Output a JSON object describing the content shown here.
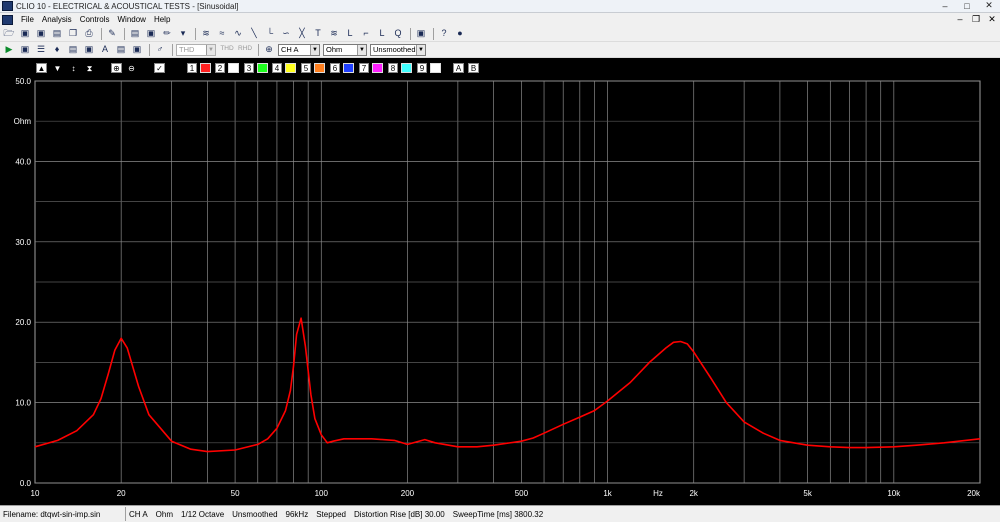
{
  "window": {
    "title": "CLIO 10 - ELECTRICAL & ACOUSTICAL TESTS - [Sinusoidal]"
  },
  "menu": [
    "File",
    "Analysis",
    "Controls",
    "Window",
    "Help"
  ],
  "toolbar2": {
    "thd_dropdown": "THD",
    "thd_label": "THD",
    "rhd_label": "RHD",
    "channel_dropdown": "CH A",
    "unit_dropdown": "Ohm",
    "smoothing_dropdown": "Unsmoothed"
  },
  "graph_toolbar": {
    "check_mark": "✓",
    "buttons": [
      "1",
      "2",
      "3",
      "4",
      "5",
      "6",
      "7",
      "8",
      "9"
    ],
    "a_label": "A",
    "b_label": "B",
    "colors": [
      "#ff2020",
      "#ffffff",
      "#20ff20",
      "#ffff20",
      "#ff8020",
      "#2040ff",
      "#ff20ff",
      "#40ffff",
      "#ffffff"
    ]
  },
  "chart_data": {
    "type": "line",
    "title": "",
    "xlabel": "Hz",
    "ylabel": "Ohm",
    "xscale": "log",
    "xlim": [
      10,
      20000
    ],
    "ylim": [
      0,
      50
    ],
    "yticks": [
      0,
      10,
      20,
      30,
      40,
      50
    ],
    "ytick_labels": [
      "0.0",
      "10.0",
      "20.0",
      "30.0",
      "40.0",
      "50.0"
    ],
    "xtick_values": [
      10,
      20,
      50,
      100,
      200,
      500,
      1000,
      2000,
      5000,
      10000,
      20000
    ],
    "xtick_labels": [
      "10",
      "20",
      "50",
      "100",
      "200",
      "500",
      "1k",
      "2k",
      "5k",
      "10k",
      "20k"
    ],
    "grid": true,
    "line_color": "#ff0000",
    "series": [
      {
        "x": [
          10,
          12,
          14,
          16,
          17,
          18,
          19,
          20,
          21,
          23,
          25,
          30,
          35,
          40,
          50,
          60,
          65,
          70,
          75,
          78,
          80,
          82,
          85,
          88,
          92,
          95,
          100,
          105,
          110,
          120,
          130,
          150,
          180,
          200,
          230,
          250,
          300,
          350,
          400,
          500,
          550,
          600,
          700,
          800,
          900,
          1000,
          1200,
          1400,
          1600,
          1700,
          1800,
          1900,
          2000,
          2300,
          2600,
          3000,
          3500,
          4000,
          5000,
          6000,
          7000,
          8000,
          10000,
          12000,
          15000,
          20000
        ],
        "y": [
          4.5,
          5.3,
          6.5,
          8.5,
          10.5,
          13.5,
          16.5,
          18.0,
          16.8,
          12.0,
          8.5,
          5.2,
          4.2,
          3.9,
          4.1,
          4.8,
          5.5,
          6.8,
          9.0,
          11.5,
          14.5,
          18.5,
          20.5,
          17.0,
          11.0,
          8.0,
          6.0,
          5.0,
          5.2,
          5.5,
          5.5,
          5.5,
          5.3,
          4.8,
          5.4,
          5.0,
          4.5,
          4.5,
          4.7,
          5.2,
          5.6,
          6.2,
          7.3,
          8.2,
          9.0,
          10.2,
          12.5,
          15.0,
          16.8,
          17.5,
          17.6,
          17.3,
          16.3,
          13.0,
          10.0,
          7.6,
          6.2,
          5.3,
          4.7,
          4.5,
          4.4,
          4.4,
          4.5,
          4.7,
          5.0,
          5.5
        ]
      }
    ]
  },
  "status": {
    "filename": "Filename: dtqwt-sin-imp.sin",
    "channel": "CH A",
    "unit": "Ohm",
    "octave": "1/12 Octave",
    "smoothing": "Unsmoothed",
    "sample_rate": "96kHz",
    "mode": "Stepped",
    "distortion": "Distortion Rise [dB] 30.00",
    "sweep": "SweepTime [ms] 3800.32"
  }
}
